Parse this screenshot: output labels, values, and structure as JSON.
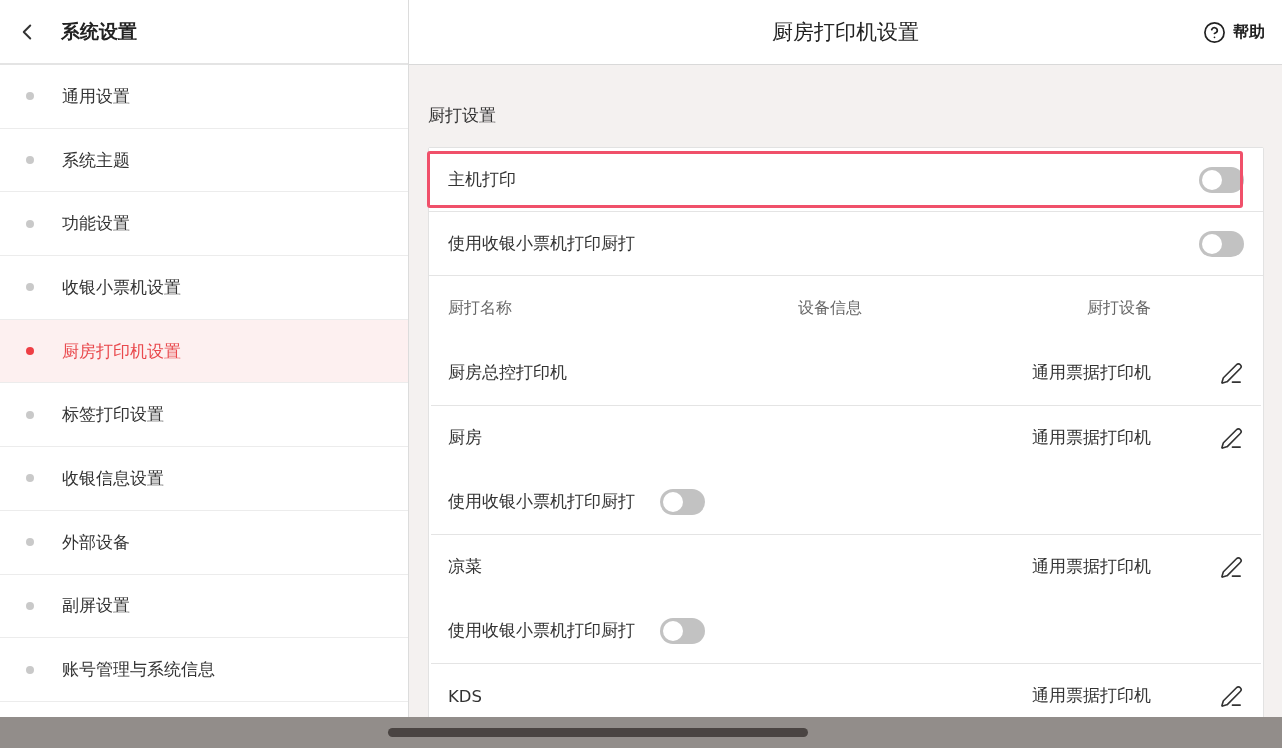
{
  "sidebar": {
    "title": "系统设置",
    "items": [
      {
        "label": "通用设置",
        "selected": false
      },
      {
        "label": "系统主题",
        "selected": false
      },
      {
        "label": "功能设置",
        "selected": false
      },
      {
        "label": "收银小票机设置",
        "selected": false
      },
      {
        "label": "厨房打印机设置",
        "selected": true
      },
      {
        "label": "标签打印设置",
        "selected": false
      },
      {
        "label": "收银信息设置",
        "selected": false
      },
      {
        "label": "外部设备",
        "selected": false
      },
      {
        "label": "副屏设置",
        "selected": false
      },
      {
        "label": "账号管理与系统信息",
        "selected": false
      }
    ]
  },
  "header": {
    "title": "厨房打印机设置",
    "help": "帮助"
  },
  "section": {
    "title": "厨打设置",
    "settings": [
      {
        "label": "主机打印",
        "on": false,
        "highlighted": true
      },
      {
        "label": "使用收银小票机打印厨打",
        "on": false,
        "highlighted": false
      }
    ]
  },
  "table": {
    "columns": [
      "厨打名称",
      "设备信息",
      "厨打设备"
    ],
    "rows": [
      {
        "name": "厨房总控打印机",
        "device": "通用票据打印机"
      },
      {
        "name": "厨房",
        "device": "通用票据打印机",
        "option": {
          "label": "使用收银小票机打印厨打",
          "on": false
        }
      },
      {
        "name": "凉菜",
        "device": "通用票据打印机",
        "option": {
          "label": "使用收银小票机打印厨打",
          "on": false
        }
      },
      {
        "name": "KDS",
        "device": "通用票据打印机"
      }
    ]
  }
}
